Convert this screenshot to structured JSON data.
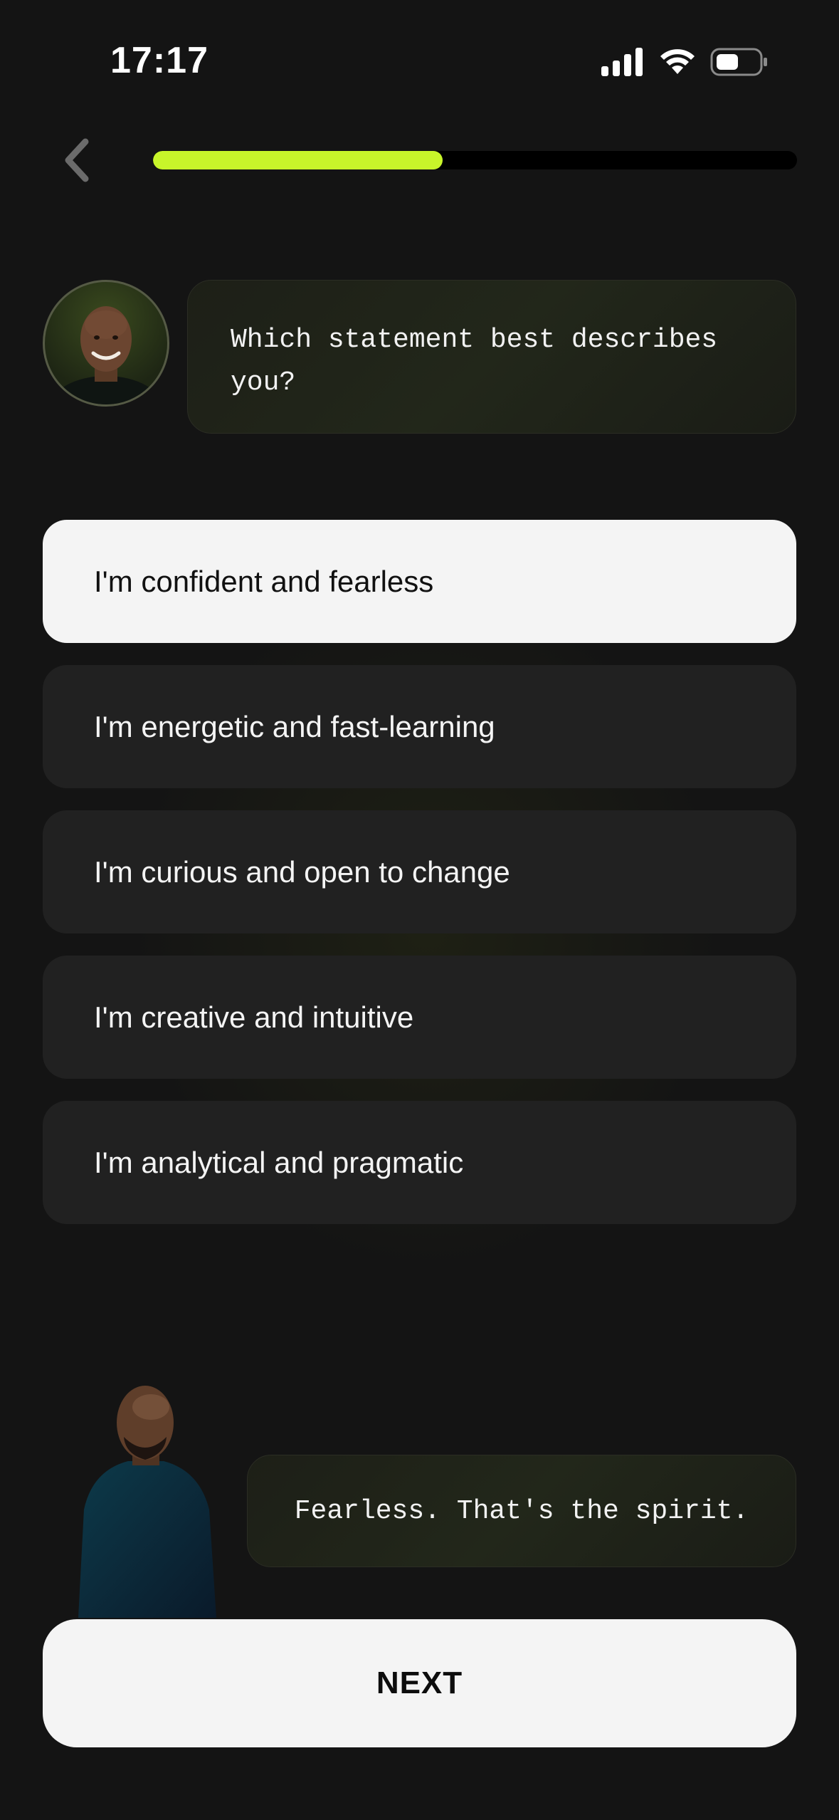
{
  "status_bar": {
    "time": "17:17",
    "icons": [
      "signal-icon",
      "wifi-icon",
      "battery-icon"
    ]
  },
  "navigation": {
    "back_icon": "chevron-left-icon",
    "progress": 0.45
  },
  "coach": {
    "avatar_icon": "coach-avatar",
    "question": "Which statement best describes you?"
  },
  "options": [
    {
      "label": "I'm confident and fearless",
      "selected": true
    },
    {
      "label": "I'm energetic and fast-learning",
      "selected": false
    },
    {
      "label": "I'm curious and open to change",
      "selected": false
    },
    {
      "label": "I'm creative and intuitive",
      "selected": false
    },
    {
      "label": "I'm analytical and pragmatic",
      "selected": false
    }
  ],
  "feedback": {
    "text": "Fearless. That's the spirit."
  },
  "next_button": {
    "label": "NEXT"
  },
  "colors": {
    "accent": "#c8f52a",
    "background": "#141414",
    "option_bg": "#212121",
    "selected_bg": "#f4f4f4"
  }
}
